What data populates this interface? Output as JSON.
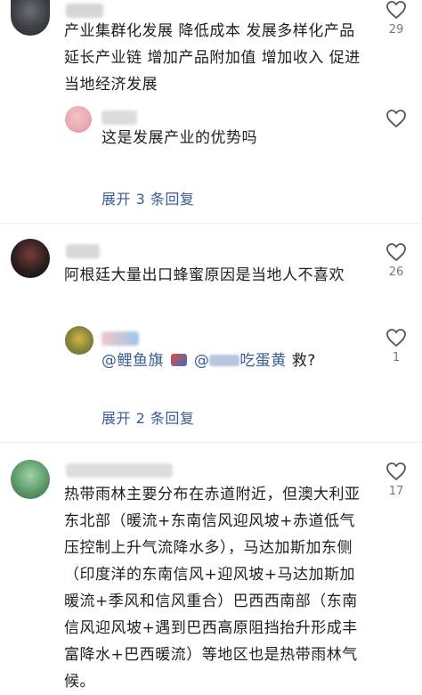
{
  "comments": [
    {
      "text": "产业集群化发展 降低成本 发展多样化产品 延长产业链 增加产品附加值 增加收入 促进当地经济发展",
      "likes": "29",
      "reply": {
        "text": "这是发展产业的优势吗"
      },
      "expand_label": "展开 3 条回复"
    },
    {
      "text": "阿根廷大量出口蜂蜜原因是当地人不喜欢",
      "likes": "26",
      "reply": {
        "mention1": "@鲤鱼旗",
        "mention2": "@",
        "mention2_suffix": "吃蛋黄",
        "text_suffix": " 救?",
        "likes": "1"
      },
      "expand_label": "展开 2 条回复"
    },
    {
      "text": "热带雨林主要分布在赤道附近，但澳大利亚东北部（暖流+东南信风迎风坡+赤道低气压控制上升气流降水多），马达加斯加东侧（印度洋的东南信风+迎风坡+马达加斯加暖流+季风和信风重合）巴西西南部（东南信风迎风坡+遇到巴西高原阻挡抬升形成丰富降水+巴西暖流）等地区也是热带雨林气候。",
      "likes": "17"
    }
  ],
  "icons": {
    "like": "heart-outline-icon"
  },
  "colors": {
    "link": "#3a5b9a",
    "text": "#1e1e1e",
    "count": "#777777"
  }
}
